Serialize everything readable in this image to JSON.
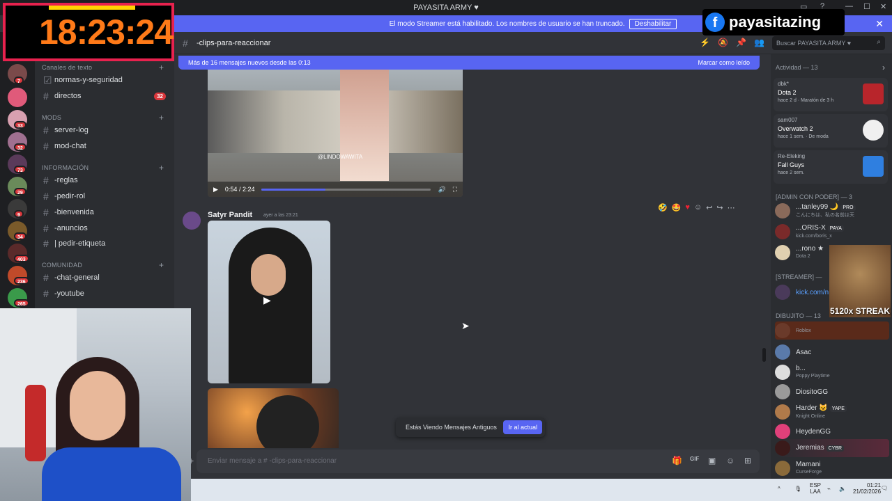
{
  "window": {
    "title": "PAYASITA ARMY ♥",
    "controls": [
      "▭",
      "?",
      "—",
      "☐",
      "✕"
    ]
  },
  "banner": {
    "text": "El modo Streamer está habilitado. Los nombres de usuario se han truncado.",
    "button": "Deshabilitar"
  },
  "overlay": {
    "timer": "18:23:24",
    "fb_name": "payasitazing",
    "streak": "5120x STREAK"
  },
  "guild_badges": [
    "7",
    "33",
    "32",
    "73",
    "29",
    "9",
    "34",
    "403",
    "236",
    "265"
  ],
  "sidebar": {
    "cat_text": "Canales de texto",
    "cat_mods": "MODS",
    "cat_info": "INFORMACIÓN",
    "cat_community": "COMUNIDAD",
    "items": [
      {
        "label": "normas-y-seguridad"
      },
      {
        "label": "directos",
        "count": "32"
      },
      {
        "label": "server-log"
      },
      {
        "label": "mod-chat"
      },
      {
        "label": "-reglas"
      },
      {
        "label": "-pedir-rol"
      },
      {
        "label": "-bienvenida"
      },
      {
        "label": "-anuncios"
      },
      {
        "label": "| pedir-etiqueta"
      },
      {
        "label": "-chat-general"
      },
      {
        "label": "-youtube"
      }
    ]
  },
  "header": {
    "channel": "-clips-para-reaccionar",
    "search_placeholder": "Buscar PAYASITA ARMY ♥"
  },
  "new_messages": {
    "text": "Más de 16 mensajes nuevos desde las 0:13",
    "action": "Marcar como leído"
  },
  "video": {
    "time": "0:54 / 2:24",
    "progress": 0.375,
    "watermark": "@LINDOWAWITA"
  },
  "message": {
    "author": "Satyr Pandit",
    "timestamp": "ayer a las 23:21"
  },
  "old_messages": {
    "text": "Estás Viendo Mensajes Antiguos",
    "button": "Ir al actual"
  },
  "composer": {
    "placeholder": "Enviar mensaje a # -clips-para-reaccionar"
  },
  "members": {
    "activity_header": "Actividad — 13",
    "activities": [
      {
        "user": "dbk*",
        "game": "Dota 2",
        "meta": "hace 2 d   ·   Maratón de 3 h",
        "color": "#b8252b"
      },
      {
        "user": "sam007",
        "game": "Overwatch 2",
        "meta": "hace 1 sem.   ·   De moda",
        "color": "#f0f0f0"
      },
      {
        "user": "Re-Eleking",
        "game": "Fall Guys",
        "meta": "hace 2 sem.",
        "color": "#2f7fe0"
      }
    ],
    "admin_header": "[ADMIN CON PODER] — 3",
    "admins": [
      {
        "name": "...tanley99 🌙",
        "sub": "こんにちは、私の名前は天",
        "tag": "PRO"
      },
      {
        "name": "...ORIS-X",
        "sub": "kick.com/boris_x",
        "tag": "PAYA"
      },
      {
        "name": "...rono ★",
        "sub": "Dota 2",
        "tag": ""
      }
    ],
    "streamer_header": "[STREAMER] —",
    "streamers": [
      {
        "name": "kick.com/n",
        "sub": ""
      }
    ],
    "dibujito_header": "DIBUJITO — 13",
    "dibujito": [
      {
        "name": "",
        "sub": "Roblox",
        "tag": ""
      },
      {
        "name": "Asac",
        "sub": "",
        "tag": ""
      },
      {
        "name": "b...",
        "sub": "Poppy Playtime",
        "tag": ""
      },
      {
        "name": "DiositoGG",
        "sub": "",
        "tag": ""
      },
      {
        "name": "Harder 😺",
        "sub": "Knight Online",
        "tag": "YAPE"
      },
      {
        "name": "HeydenGG",
        "sub": "",
        "tag": ""
      },
      {
        "name": "Jeremias",
        "sub": "",
        "tag": "CYBR"
      },
      {
        "name": "Mamani",
        "sub": "CurseForge",
        "tag": ""
      }
    ]
  },
  "taskbar": {
    "lang": "ESP",
    "layout": "LAA",
    "time": "01:21",
    "date": "21/02/2026"
  }
}
